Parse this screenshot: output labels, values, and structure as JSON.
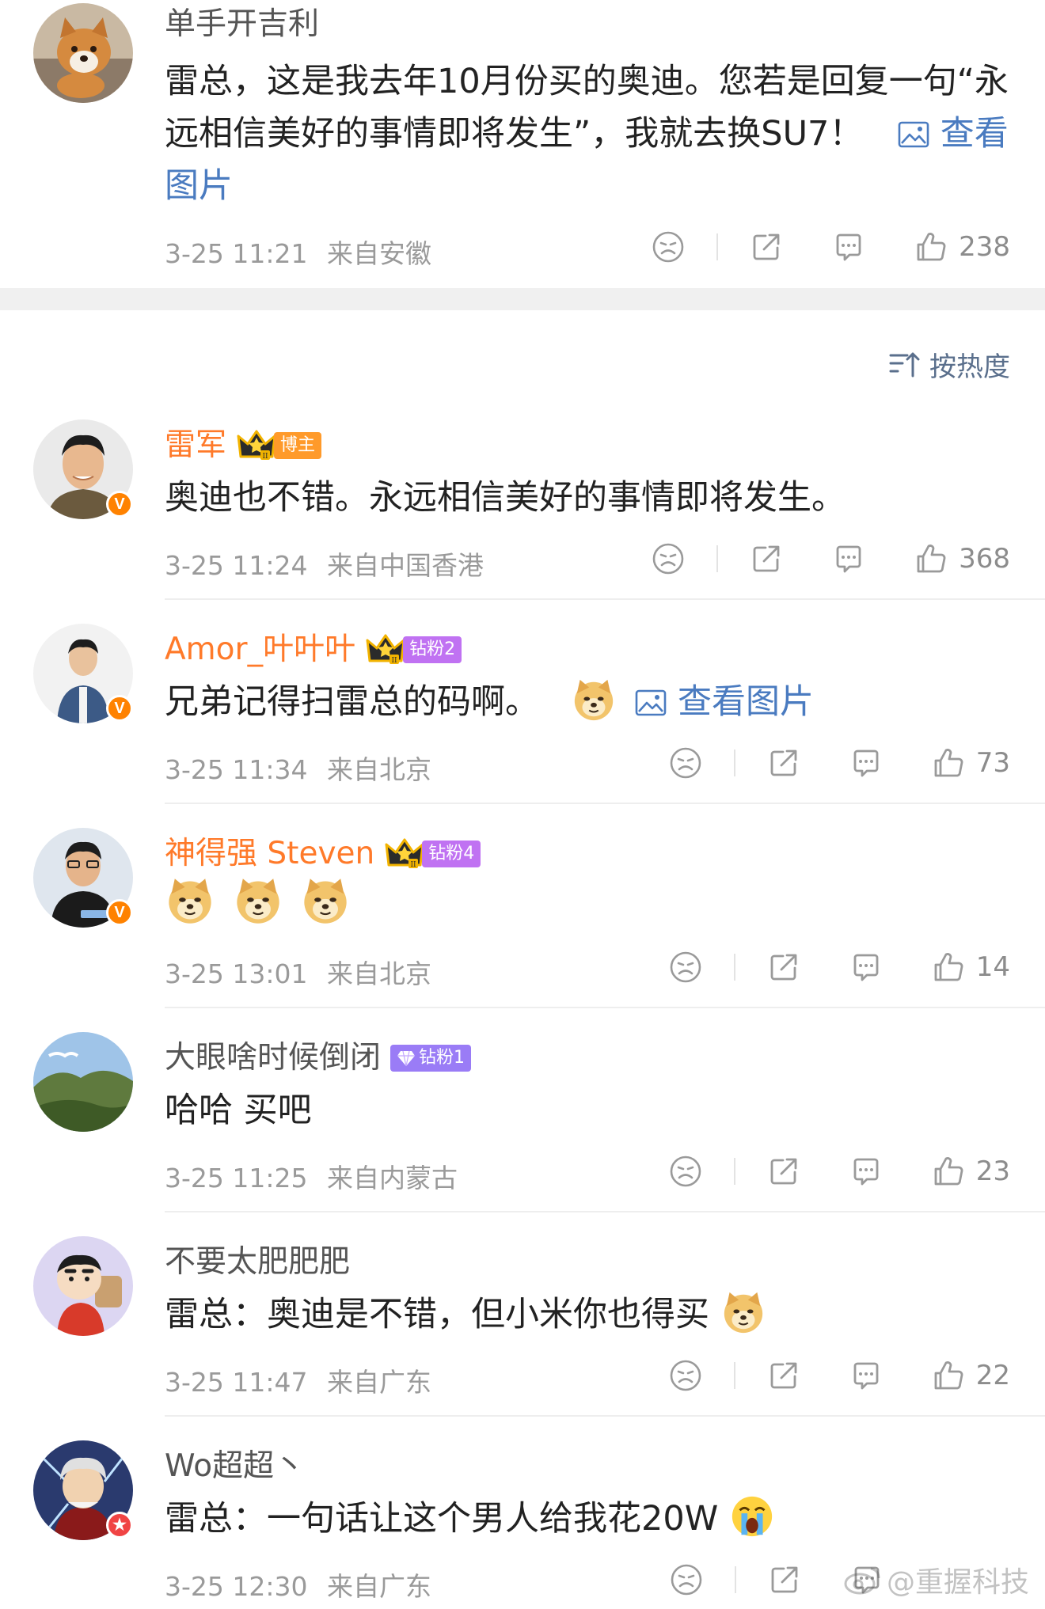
{
  "top_comment": {
    "username": "单手开吉利",
    "text": "雷总，这是我去年10月份买的奥迪。您若是回复一句“永远相信美好的事情即将发生”，我就去换SU7！",
    "image_link": "查看图片",
    "time": "3-25 11:21",
    "location": "来自安徽",
    "likes": "238"
  },
  "sort": {
    "label": "按热度"
  },
  "comments": [
    {
      "username": "雷军",
      "badge": "博主",
      "text": "奥迪也不错。永远相信美好的事情即将发生。",
      "time": "3-25 11:24",
      "location": "来自中国香港",
      "likes": "368"
    },
    {
      "username": "Amor_叶叶叶",
      "badge": "钻粉2",
      "text": "兄弟记得扫雷总的码啊。",
      "image_link": "查看图片",
      "time": "3-25 11:34",
      "location": "来自北京",
      "likes": "73"
    },
    {
      "username": "神得强 Steven",
      "badge": "钻粉4",
      "time": "3-25 13:01",
      "location": "来自北京",
      "likes": "14"
    },
    {
      "username": "大眼啥时候倒闭",
      "badge": "钻粉1",
      "text": "哈哈 买吧",
      "time": "3-25 11:25",
      "location": "来自内蒙古",
      "likes": "23"
    },
    {
      "username": "不要太肥肥肥",
      "text": "雷总：奥迪是不错，但小米你也得买",
      "time": "3-25 11:47",
      "location": "来自广东",
      "likes": "22"
    },
    {
      "username": "Wo超超丶",
      "text": "雷总：一句话让这个男人给我花20W",
      "time": "3-25 12:30",
      "location": "来自广东"
    }
  ],
  "watermark": "@重握科技",
  "colors": {
    "vip_name": "#ff7a2a",
    "link": "#4a7bc0",
    "meta": "#9a9a9a"
  }
}
